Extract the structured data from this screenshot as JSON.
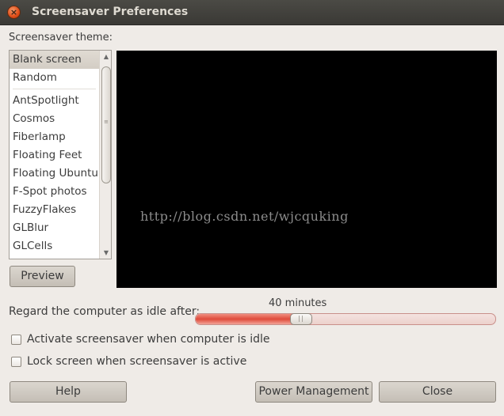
{
  "window": {
    "title": "Screensaver Preferences",
    "close_glyph": "×"
  },
  "theme": {
    "label": "Screensaver theme:",
    "items_top": [
      "Blank screen",
      "Random"
    ],
    "items": [
      "AntSpotlight",
      "Cosmos",
      "Fiberlamp",
      "Floating Feet",
      "Floating Ubuntu",
      "F-Spot photos",
      "FuzzyFlakes",
      "GLBlur",
      "GLCells"
    ],
    "selected": "Blank screen"
  },
  "preview": {
    "button_label": "Preview",
    "watermark": "http://blog.csdn.net/wjcquking"
  },
  "idle": {
    "label": "Regard the computer as idle after:",
    "value_text": "40 minutes",
    "fraction": 0.34
  },
  "options": {
    "activate_label": "Activate screensaver when computer is idle",
    "activate_checked": false,
    "lock_label": "Lock screen when screensaver is active",
    "lock_checked": false
  },
  "buttons": {
    "help": "Help",
    "power": "Power Management",
    "close": "Close"
  },
  "colors": {
    "accent": "#df4b3b",
    "titlebar": "#3c3b37",
    "preview_bg": "#000000"
  },
  "icons": {
    "close": "close-icon",
    "scroll_up": "scroll-up-arrow-icon",
    "scroll_down": "scroll-down-arrow-icon"
  }
}
